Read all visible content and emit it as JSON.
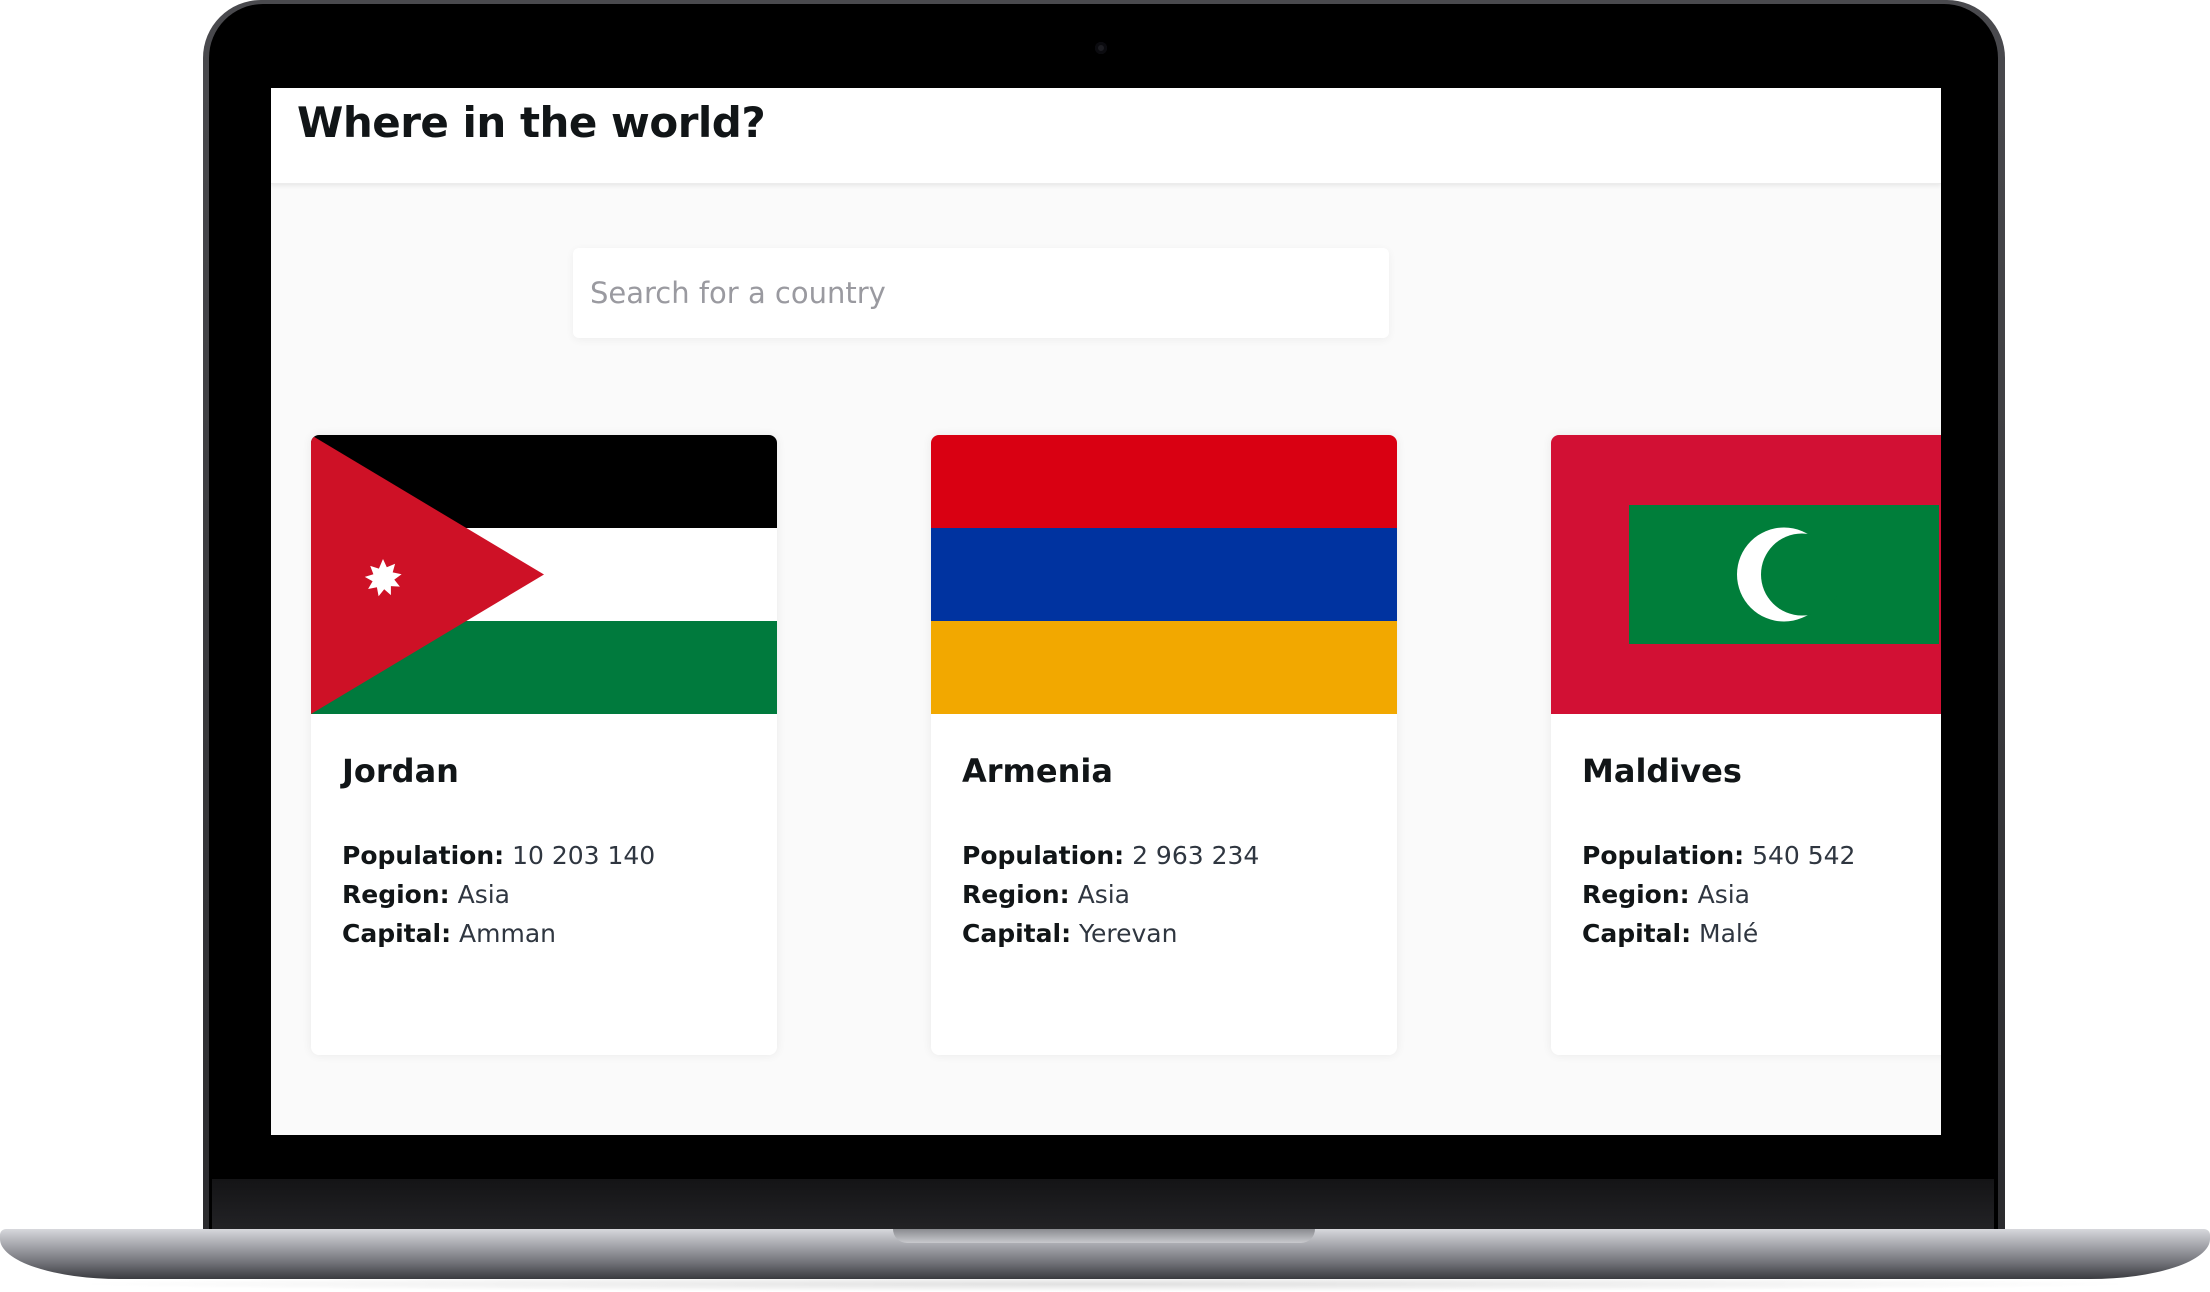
{
  "header": {
    "title": "Where in the world?"
  },
  "search": {
    "placeholder": "Search for a country",
    "value": ""
  },
  "labels": {
    "population": "Population:",
    "region": "Region:",
    "capital": "Capital:"
  },
  "countries": [
    {
      "name": "Jordan",
      "population": "10 203 140",
      "region": "Asia",
      "capital": "Amman",
      "flag_icon": "jordan-flag",
      "flag_colors": [
        "#000000",
        "#ffffff",
        "#007a3d",
        "#ce1126"
      ]
    },
    {
      "name": "Armenia",
      "population": "2 963 234",
      "region": "Asia",
      "capital": "Yerevan",
      "flag_icon": "armenia-flag",
      "flag_colors": [
        "#d90012",
        "#0033a0",
        "#f2a800"
      ]
    },
    {
      "name": "Maldives",
      "population": "540 542",
      "region": "Asia",
      "capital": "Malé",
      "flag_icon": "maldives-flag",
      "flag_colors": [
        "#d21034",
        "#007e3a",
        "#ffffff"
      ]
    }
  ]
}
